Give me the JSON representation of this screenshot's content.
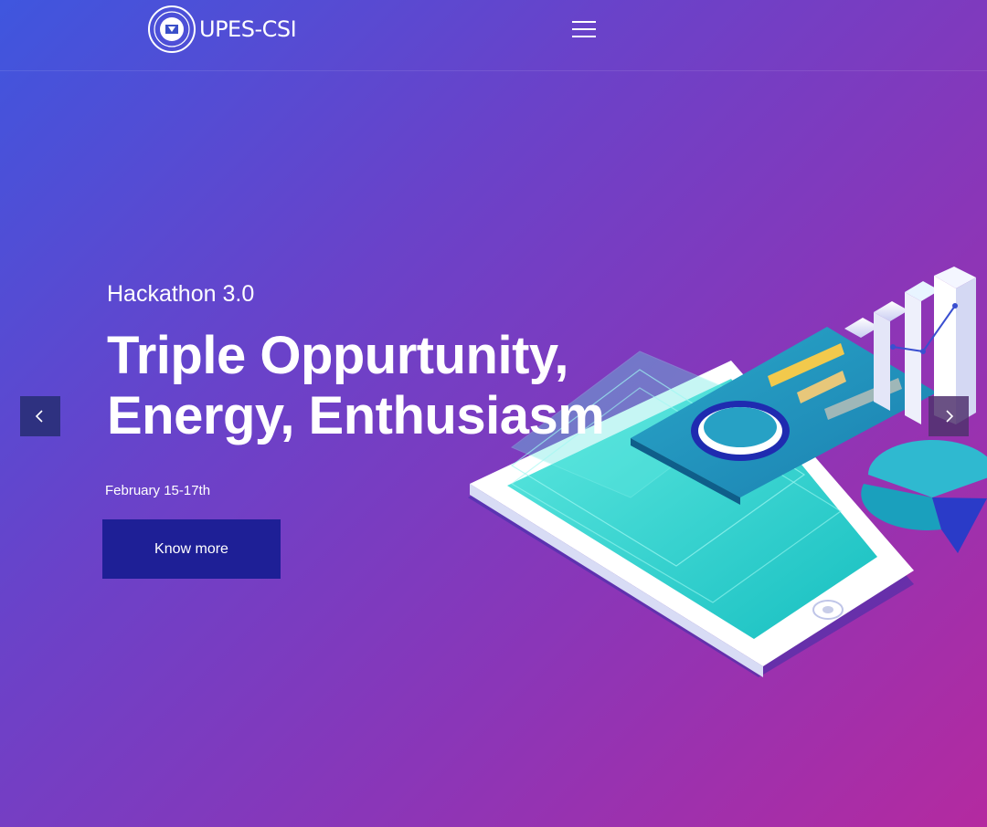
{
  "header": {
    "brand": "UPES-CSI",
    "logo_icon": "csi-seal-logo",
    "menu_icon": "hamburger-menu-icon"
  },
  "hero": {
    "subtitle": "Hackathon 3.0",
    "headline_line1": "Triple Oppurtunity,",
    "headline_line2": "Energy, Enthusiasm",
    "date": "February 15-17th",
    "cta_label": "Know more"
  },
  "carousel": {
    "prev_icon": "chevron-left-icon",
    "next_icon": "chevron-right-icon"
  },
  "colors": {
    "gradient_start": "#3f56de",
    "gradient_end": "#b42aa0",
    "cta_background": "#1e1f96",
    "illustration_accent": "#25d6c8"
  }
}
